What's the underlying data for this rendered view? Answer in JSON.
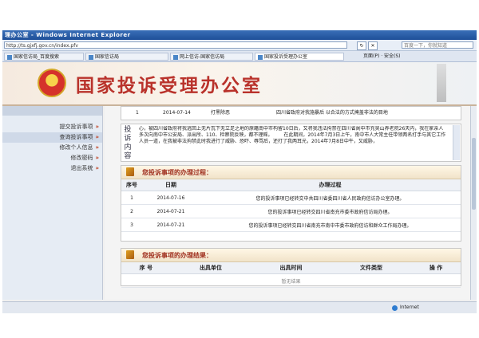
{
  "browser": {
    "title": "理办公室 - Windows Internet Explorer",
    "url": "http://ts.gjxfj.gov.cn/index.pfv",
    "search_placeholder": "百度一下，你就知道",
    "tabs": [
      {
        "label": "国家信访局_百度搜索"
      },
      {
        "label": "国家信访局"
      },
      {
        "label": "网上信访-国家信访局"
      },
      {
        "label": "国家投诉受理办公室"
      }
    ],
    "tools_label": "页面(P) · 安全(S)",
    "status_zone": "Internet"
  },
  "banner": {
    "title": "国家投诉受理办公室"
  },
  "sidebar": {
    "items": [
      {
        "label": "提交投诉事项"
      },
      {
        "label": "查询投诉事项"
      },
      {
        "label": "修改个人信息"
      },
      {
        "label": "修改密码"
      },
      {
        "label": "退出系统"
      }
    ],
    "arrow": "»"
  },
  "summary_row": {
    "seq": "1",
    "date": "2014-07-14",
    "type": "打黑除恶",
    "desc": "四川省政府对我施暴后 以合法的方式掩盖非法的目地"
  },
  "complaint": {
    "label": "投诉内容",
    "text": "心，被四川省政府将我逃回上无片瓦下无立足之地的原籍南中市构留10日后，又将我违法拘禁在四川省阆中市充昊山养老院26天内，我在家亲人多次向南中市公安局、派出所、110、检察院反映，都不理睬。\n　　在此期间，2014年7月3日上午，南中市人大常主任带领两名打手与其它工作人员一道，在我被非法拘禁此时我进行了威胁、恐吓、辱骂后，还打了我两耳光，2014年7月8日中午，又威胁，"
  },
  "process": {
    "title": "您投诉事项的办理过程：",
    "headers": [
      "序号",
      "日期",
      "办理过程"
    ],
    "rows": [
      {
        "seq": "1",
        "date": "2014-07-16",
        "text": "您的投诉事项已经转交中共四川省委四川省人民政府信访办公室办理。"
      },
      {
        "seq": "2",
        "date": "2014-07-21",
        "text": "您的投诉事项已经转交四川省南充市委市政府信访局办理。"
      },
      {
        "seq": "3",
        "date": "2014-07-21",
        "text": "您的投诉事项已经转交四川省南充市南中市委市政府信访和群众工作局办理。"
      }
    ]
  },
  "result": {
    "title": "您投诉事项的办理结果：",
    "headers": [
      "序 号",
      "出具单位",
      "出具时间",
      "文件类型",
      "操 作"
    ],
    "empty_label": "暂无结果"
  }
}
